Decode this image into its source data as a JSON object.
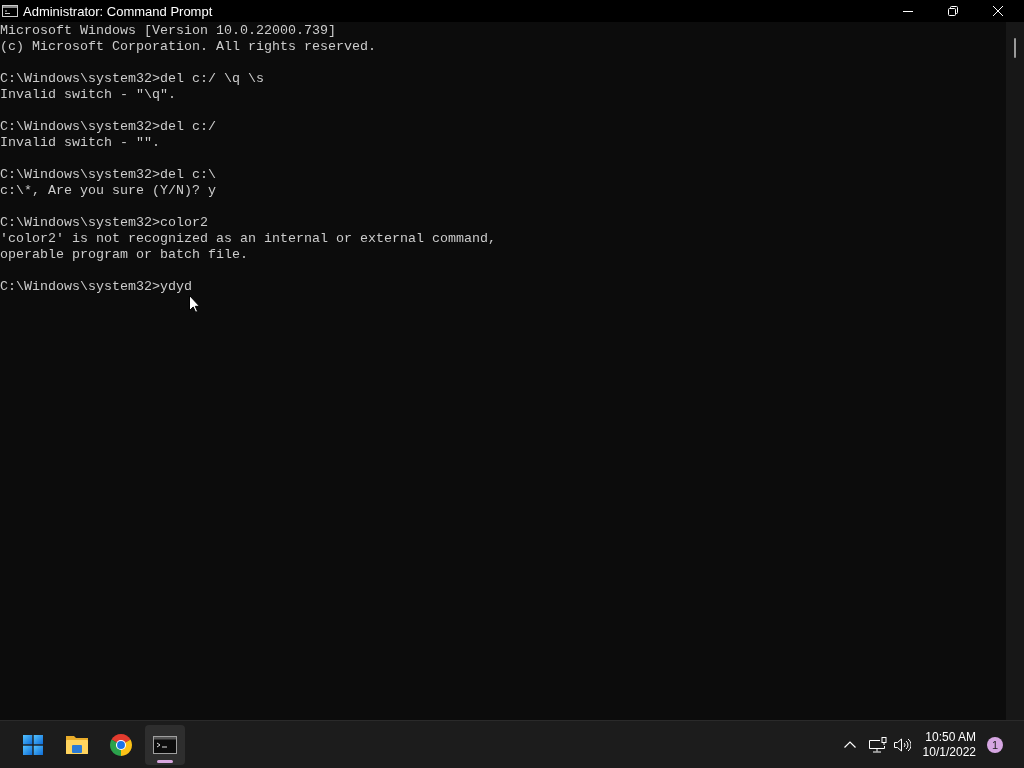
{
  "window": {
    "title": "Administrator: Command Prompt"
  },
  "console": {
    "blocks": [
      [
        "Microsoft Windows [Version 10.0.22000.739]",
        "(c) Microsoft Corporation. All rights reserved."
      ],
      [
        "C:\\Windows\\system32>del c:/ \\q \\s",
        "Invalid switch - \"\\q\"."
      ],
      [
        "C:\\Windows\\system32>del c:/",
        "Invalid switch - \"\"."
      ],
      [
        "C:\\Windows\\system32>del c:\\",
        "c:\\*, Are you sure (Y/N)? y"
      ],
      [
        "C:\\Windows\\system32>color2",
        "'color2' is not recognized as an internal or external command,",
        "operable program or batch file."
      ],
      [
        "C:\\Windows\\system32>ydyd"
      ]
    ]
  },
  "taskbar": {
    "apps": [
      {
        "kind": "start",
        "selected": false
      },
      {
        "kind": "folder",
        "selected": false
      },
      {
        "kind": "browser",
        "selected": false
      },
      {
        "kind": "terminal",
        "selected": true
      }
    ],
    "clock": {
      "time": "10:50 AM",
      "date": "10/1/2022"
    },
    "notification_badge": "1"
  }
}
